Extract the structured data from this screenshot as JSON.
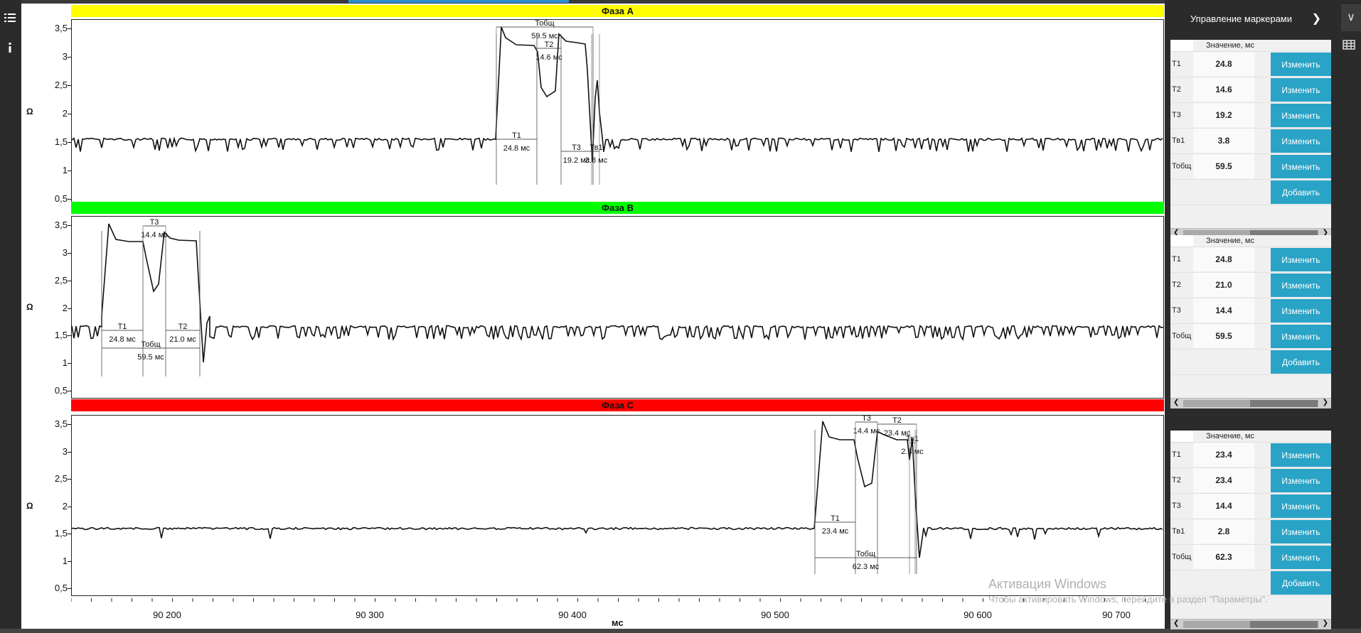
{
  "left_toolbar": {
    "icons": [
      "list-icon",
      "info-icon"
    ]
  },
  "phases": [
    {
      "id": "A",
      "title": "Фаза A",
      "color": "#ffff00",
      "ylabel": "Ω",
      "yticks": [
        "3,5",
        "3",
        "2,5",
        "2",
        "1,5",
        "1",
        "0,5"
      ],
      "annotations": [
        {
          "label": "Тобщ",
          "value": "59.5 мс"
        },
        {
          "label": "T2",
          "value": "14.6 мс"
        },
        {
          "label": "T1",
          "value": "24.8 мс"
        },
        {
          "label": "T3",
          "value": "19.2 мс"
        },
        {
          "label": "Тв1",
          "value": "3.8 мс"
        }
      ]
    },
    {
      "id": "B",
      "title": "Фаза B",
      "color": "#00ff00",
      "ylabel": "Ω",
      "yticks": [
        "3,5",
        "3",
        "2,5",
        "2",
        "1,5",
        "1",
        "0,5"
      ],
      "annotations": [
        {
          "label": "T3",
          "value": "14.4 мс"
        },
        {
          "label": "T1",
          "value": "24.8 мс"
        },
        {
          "label": "T2",
          "value": "21.0 мс"
        },
        {
          "label": "Тобщ",
          "value": "59.5 мс"
        }
      ]
    },
    {
      "id": "C",
      "title": "Фаза C",
      "color": "#ff0000",
      "ylabel": "Ω",
      "yticks": [
        "3,5",
        "3",
        "2,5",
        "2",
        "1,5",
        "1",
        "0,5"
      ],
      "annotations": [
        {
          "label": "T3",
          "value": "14.4 мс"
        },
        {
          "label": "T2",
          "value": "23.4 мс"
        },
        {
          "label": "Тв1",
          "value": "2.8 мс"
        },
        {
          "label": "T1",
          "value": "23.4 мс"
        },
        {
          "label": "Тобщ",
          "value": "62.3 мс"
        }
      ]
    }
  ],
  "x_axis": {
    "label": "мс",
    "ticks": [
      "90 200",
      "90 300",
      "90 400",
      "90 500",
      "90 600",
      "90 700"
    ]
  },
  "right_panel": {
    "title": "Управление маркерами",
    "column_header": "Значение, мс",
    "button_change": "Изменить",
    "button_add": "Добавить",
    "groups": [
      {
        "rows": [
          {
            "name": "T1",
            "value": "24.8"
          },
          {
            "name": "T2",
            "value": "14.6"
          },
          {
            "name": "T3",
            "value": "19.2"
          },
          {
            "name": "Тв1",
            "value": "3.8"
          },
          {
            "name": "Тобщ",
            "value": "59.5"
          }
        ]
      },
      {
        "rows": [
          {
            "name": "T1",
            "value": "24.8"
          },
          {
            "name": "T2",
            "value": "21.0"
          },
          {
            "name": "T3",
            "value": "14.4"
          },
          {
            "name": "Тобщ",
            "value": "59.5"
          }
        ]
      },
      {
        "rows": [
          {
            "name": "T1",
            "value": "23.4"
          },
          {
            "name": "T2",
            "value": "23.4"
          },
          {
            "name": "T3",
            "value": "14.4"
          },
          {
            "name": "Тв1",
            "value": "2.8"
          },
          {
            "name": "Тобщ",
            "value": "62.3"
          }
        ]
      }
    ]
  },
  "watermark": {
    "line1": "Активация Windows",
    "line2": "Чтобы активировать Windows, перейдите в раздел \"Параметры\"."
  }
}
